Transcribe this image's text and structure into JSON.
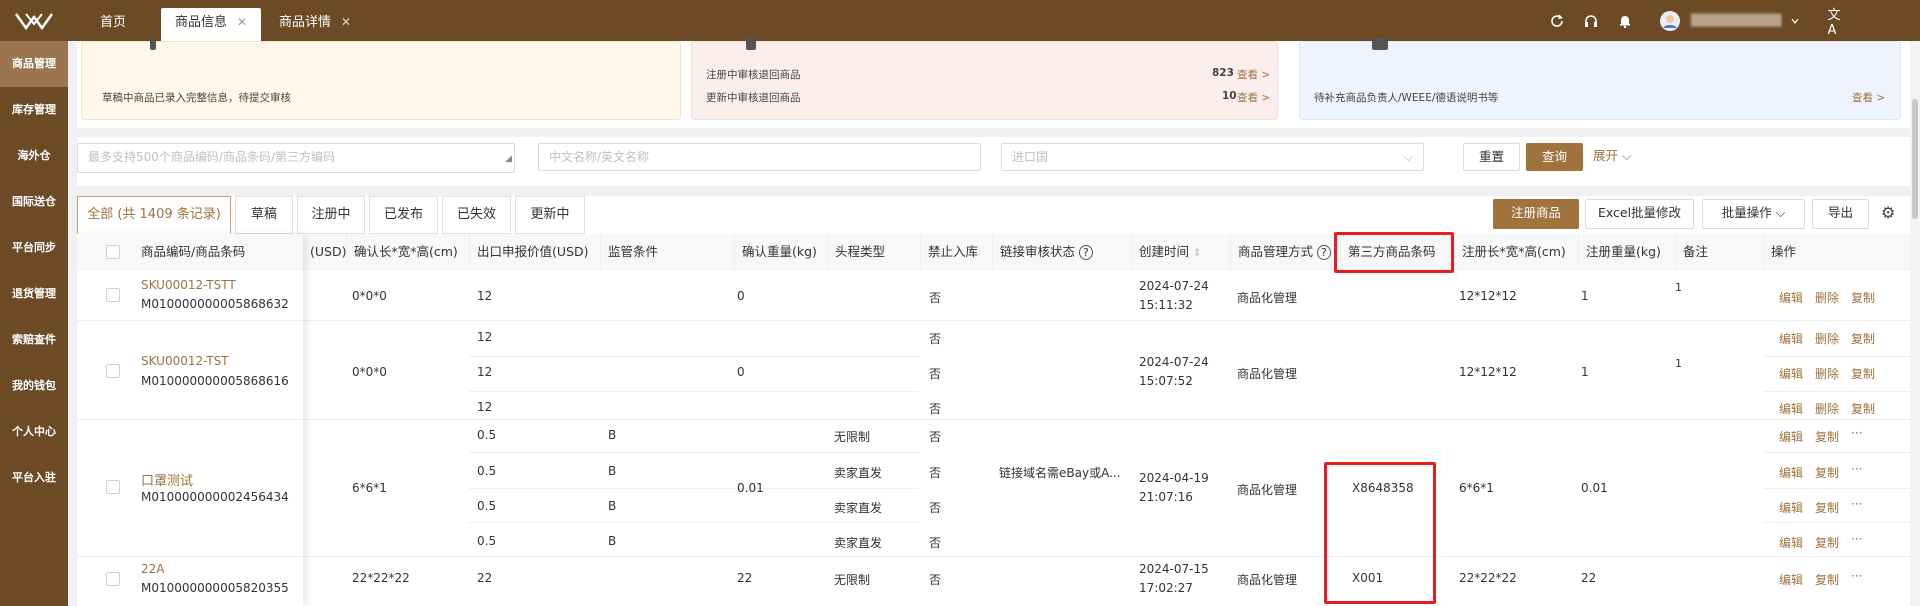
{
  "tabs": [
    {
      "label": "首页"
    },
    {
      "label": "商品信息"
    },
    {
      "label": "商品详情"
    }
  ],
  "header": {
    "user_name": "████████████"
  },
  "sidebar": {
    "items": [
      {
        "label": "商品管理"
      },
      {
        "label": "库存管理"
      },
      {
        "label": "海外仓"
      },
      {
        "label": "国际送仓"
      },
      {
        "label": "平台同步"
      },
      {
        "label": "退货管理"
      },
      {
        "label": "索赔查件"
      },
      {
        "label": "我的钱包"
      },
      {
        "label": "个人中心"
      },
      {
        "label": "平台入驻"
      }
    ]
  },
  "cards": {
    "draft": {
      "text": "草稿中商品已录入完整信息，待提交审核"
    },
    "review": {
      "rows": [
        {
          "label": "注册中审核退回商品",
          "count": "823",
          "link": "查看 >"
        },
        {
          "label": "更新中审核退回商品",
          "count": "10",
          "link": "查看 >"
        }
      ]
    },
    "pending": {
      "text": "待补充商品负责人/WEEE/德语说明书等",
      "link": "查看 >"
    }
  },
  "search": {
    "codes_placeholder": "最多支持500个商品编码/商品条码/第三方编码",
    "name_placeholder": "中文名称/英文名称",
    "country_placeholder": "进口国",
    "reset_label": "重置",
    "query_label": "查询",
    "expand_label": "展开"
  },
  "status_tabs": [
    {
      "label": "全部 (共 1409 条记录)"
    },
    {
      "label": "草稿"
    },
    {
      "label": "注册中"
    },
    {
      "label": "已发布"
    },
    {
      "label": "已失效"
    },
    {
      "label": "更新中"
    }
  ],
  "actions": {
    "register_label": "注册商品",
    "excel_label": "Excel批量修改",
    "batch_label": "批量操作",
    "export_label": "导出"
  },
  "columns": {
    "code": "商品编码/商品条码",
    "usd": "(USD)",
    "dims": "确认长*宽*高(cm)",
    "export_value": "出口申报价值(USD)",
    "supervision": "监管条件",
    "weight": "确认重量(kg)",
    "head_type": "头程类型",
    "forbid": "禁止入库",
    "link_status": "链接审核状态",
    "created": "创建时间",
    "mgmt": "商品管理方式",
    "third_code": "第三方商品条码",
    "reg_dims": "注册长*宽*高(cm)",
    "reg_weight": "注册重量(kg)",
    "remark": "备注",
    "ops": "操作"
  },
  "rows": [
    {
      "sku": "SKU00012-TSTT",
      "code": "M010000000005868632",
      "dims": "0*0*0",
      "weight": "0",
      "date": "2024-07-24",
      "time": "15:11:32",
      "mgmt": "商品化管理",
      "third": "",
      "reg_dims": "12*12*12",
      "reg_weight": "1",
      "remark": "1",
      "sub": [
        {
          "export": "12",
          "supervision": "",
          "head": "",
          "forbid": "否",
          "ops": [
            "编辑",
            "删除",
            "复制"
          ]
        }
      ]
    },
    {
      "sku": "SKU00012-TST",
      "code": "M010000000005868616",
      "dims": "0*0*0",
      "weight": "0",
      "date": "2024-07-24",
      "time": "15:07:52",
      "mgmt": "商品化管理",
      "third": "",
      "reg_dims": "12*12*12",
      "reg_weight": "1",
      "remark": "1",
      "sub": [
        {
          "export": "12",
          "supervision": "",
          "head": "",
          "forbid": "否",
          "ops": [
            "编辑",
            "删除",
            "复制"
          ]
        },
        {
          "export": "12",
          "supervision": "",
          "head": "",
          "forbid": "否",
          "ops": [
            "编辑",
            "删除",
            "复制"
          ]
        },
        {
          "export": "12",
          "supervision": "",
          "head": "",
          "forbid": "否",
          "ops": [
            "编辑",
            "删除",
            "复制"
          ]
        }
      ]
    },
    {
      "sku": "口罩测试",
      "code": "M010000000002456434",
      "dims": "6*6*1",
      "weight": "0.01",
      "link_status": "链接域名需eBay或A...",
      "date": "2024-04-19",
      "time": "21:07:16",
      "mgmt": "商品化管理",
      "third": "X8648358",
      "reg_dims": "6*6*1",
      "reg_weight": "0.01",
      "remark": "",
      "sub": [
        {
          "export": "0.5",
          "supervision": "B",
          "head": "无限制",
          "forbid": "否",
          "ops": [
            "编辑",
            "复制",
            "···"
          ]
        },
        {
          "export": "0.5",
          "supervision": "B",
          "head": "卖家直发",
          "forbid": "否",
          "ops": [
            "编辑",
            "复制",
            "···"
          ]
        },
        {
          "export": "0.5",
          "supervision": "B",
          "head": "卖家直发",
          "forbid": "否",
          "ops": [
            "编辑",
            "复制",
            "···"
          ]
        },
        {
          "export": "0.5",
          "supervision": "B",
          "head": "卖家直发",
          "forbid": "否",
          "ops": [
            "编辑",
            "复制",
            "···"
          ]
        }
      ]
    },
    {
      "sku": "22A",
      "code": "M010000000005820355",
      "dims": "22*22*22",
      "weight": "22",
      "date": "2024-07-15",
      "time": "17:02:27",
      "mgmt": "商品化管理",
      "third": "X001",
      "reg_dims": "22*22*22",
      "reg_weight": "22",
      "remark": "",
      "sub": [
        {
          "export": "22",
          "supervision": "",
          "head": "无限制",
          "forbid": "否",
          "ops": [
            "编辑",
            "复制",
            "···"
          ]
        }
      ]
    }
  ],
  "colors": {
    "brand": "#6b4a25",
    "accent": "#a0723c",
    "highlight": "#e81e1e"
  }
}
